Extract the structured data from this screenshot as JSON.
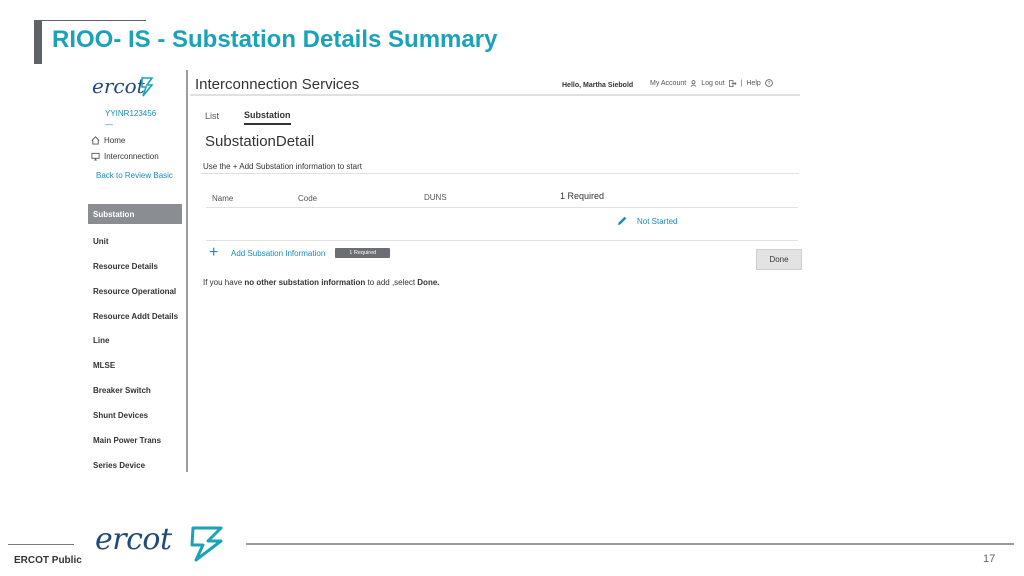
{
  "slide": {
    "title": "RIOO- IS  - Substation Details Summary"
  },
  "sidebar": {
    "brand": "ercot",
    "app_id": "YYINR123456",
    "app_id_dash": "—",
    "home_label": "Home",
    "interconnection_label": "Interconnection",
    "back_link": "Back to Review Basic",
    "items": [
      {
        "label": "Substation",
        "active": true
      },
      {
        "label": "Unit"
      },
      {
        "label": "Resource Details"
      },
      {
        "label": "Resource Operational"
      },
      {
        "label": "Resource Addt Details"
      },
      {
        "label": "Line"
      },
      {
        "label": "MLSE"
      },
      {
        "label": "Breaker Switch"
      },
      {
        "label": "Shunt Devices"
      },
      {
        "label": "Main Power Trans"
      },
      {
        "label": "Series Device"
      }
    ]
  },
  "header": {
    "app_name": "Interconnection Services",
    "greeting": "Hello, Martha Siebold",
    "my_account": "My Account",
    "logout": "Log out",
    "separator": "|",
    "help": "Help"
  },
  "tabs": {
    "list": "List",
    "substation": "Substation"
  },
  "main": {
    "section_title": "SubstationDetail",
    "instruction": "Use the + Add Substation information to start",
    "table": {
      "col_name": "Name",
      "col_code": "Code",
      "col_duns": "DUNS",
      "required": "1 Required"
    },
    "status": "Not Started",
    "add_label": "Add Subsation Information",
    "add_badge": "1 Required",
    "done_label": "Done",
    "footnote_pre": "If you have ",
    "footnote_bold": "no other substation information",
    "footnote_mid": " to add ,select ",
    "footnote_done": "Done."
  },
  "footer": {
    "logo": "ercot",
    "classification": "ERCOT Public",
    "page_number": "17"
  },
  "colors": {
    "accent": "#1aa3b8",
    "link": "#1a8bb8",
    "brand": "#1f4a7a",
    "active_nav": "#8a8d91"
  }
}
